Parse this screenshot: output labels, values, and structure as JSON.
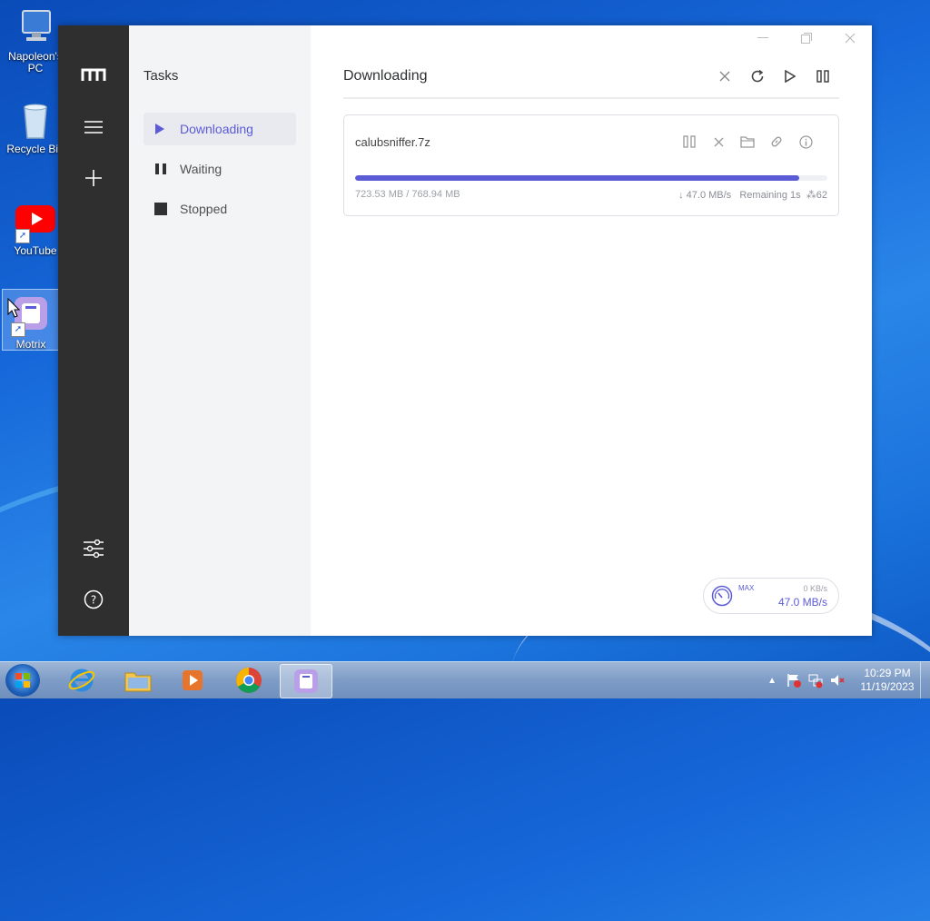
{
  "desktop": {
    "icons": [
      {
        "label": "Napoleon's PC"
      },
      {
        "label": "Recycle Bin"
      },
      {
        "label": "YouTube"
      },
      {
        "label": "Motrix"
      }
    ]
  },
  "app": {
    "sidebar": {
      "title": "Tasks",
      "items": [
        {
          "label": "Downloading",
          "icon": "play-icon",
          "active": true
        },
        {
          "label": "Waiting",
          "icon": "pause-icon",
          "active": false
        },
        {
          "label": "Stopped",
          "icon": "stop-icon",
          "active": false
        }
      ]
    },
    "main": {
      "title": "Downloading",
      "task": {
        "filename": "calubsniffer.7z",
        "progress_fraction": 0.941,
        "sizes": "723.53 MB / 768.94 MB",
        "speed": "↓ 47.0 MB/s",
        "remaining": "Remaining 1s",
        "connections": "62"
      },
      "speedometer": {
        "max_label": "MAX",
        "upload": "0 KB/s",
        "download": "47.0 MB/s"
      }
    },
    "accent_color": "#5b5bd6"
  },
  "taskbar": {
    "time": "10:29 PM",
    "date": "11/19/2023"
  }
}
